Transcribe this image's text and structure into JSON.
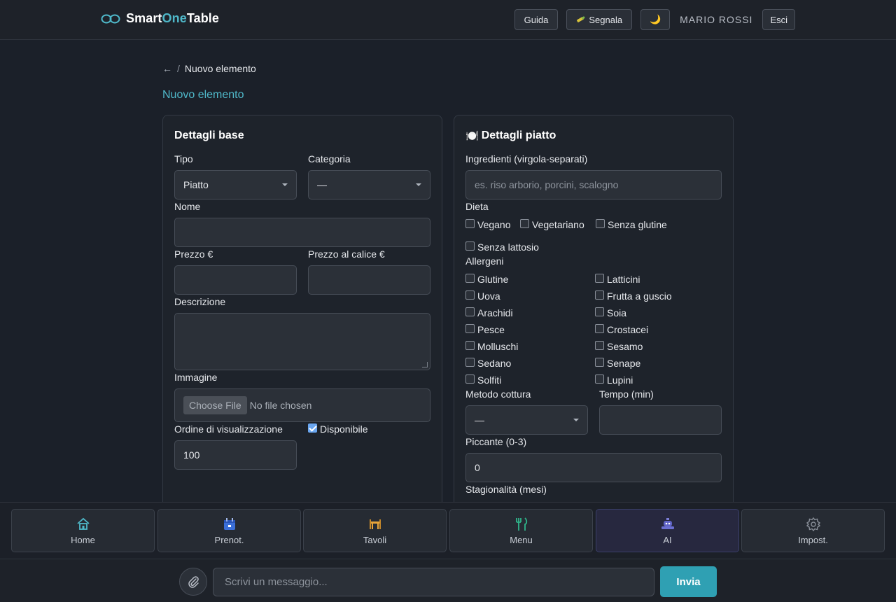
{
  "header": {
    "brand_part1": "Smart",
    "brand_part2": "One",
    "brand_part3": "Table",
    "guide_label": "Guida",
    "report_label": "Segnala",
    "theme_icon": "🌙",
    "user_name": "MARIO ROSSI",
    "logout_label": "Esci"
  },
  "breadcrumb": {
    "back_icon": "←",
    "separator": "/",
    "current": "Nuovo elemento"
  },
  "page_title": "Nuovo elemento",
  "basic": {
    "title": "Dettagli base",
    "type_label": "Tipo",
    "type_value": "Piatto",
    "category_label": "Categoria",
    "category_value": "—",
    "name_label": "Nome",
    "name_value": "",
    "price_label": "Prezzo €",
    "price_value": "",
    "glass_price_label": "Prezzo al calice €",
    "glass_price_value": "",
    "description_label": "Descrizione",
    "description_value": "",
    "image_label": "Immagine",
    "file_button": "Choose File",
    "file_status": "No file chosen",
    "order_label": "Ordine di visualizzazione",
    "order_value": "100",
    "available_label": "Disponibile",
    "available_checked": true
  },
  "dish": {
    "title_icon": "🍽️",
    "title": "Dettagli piatto",
    "ingredients_label": "Ingredienti (virgola-separati)",
    "ingredients_placeholder": "es. riso arborio, porcini, scalogno",
    "diet_label": "Dieta",
    "diet_options": [
      "Vegano",
      "Vegetariano",
      "Senza glutine",
      "Senza lattosio"
    ],
    "allergens_label": "Allergeni",
    "allergens": [
      "Glutine",
      "Latticini",
      "Uova",
      "Frutta a guscio",
      "Arachidi",
      "Soia",
      "Pesce",
      "Crostacei",
      "Molluschi",
      "Sesamo",
      "Sedano",
      "Senape",
      "Solfiti",
      "Lupini"
    ],
    "cooking_label": "Metodo cottura",
    "cooking_value": "—",
    "time_label": "Tempo (min)",
    "time_value": "",
    "spicy_label": "Piccante (0-3)",
    "spicy_value": "0",
    "season_label": "Stagionalità (mesi)"
  },
  "nav": {
    "items": [
      {
        "label": "Home",
        "icon": "home-icon"
      },
      {
        "label": "Prenot.",
        "icon": "calendar-icon"
      },
      {
        "label": "Tavoli",
        "icon": "table-icon"
      },
      {
        "label": "Menu",
        "icon": "cutlery-icon"
      },
      {
        "label": "AI",
        "icon": "robot-icon"
      },
      {
        "label": "Impost.",
        "icon": "gear-icon"
      }
    ],
    "active": "AI"
  },
  "chat": {
    "placeholder": "Scrivi un messaggio...",
    "send_label": "Invia"
  },
  "colors": {
    "accent": "#4fb8c9",
    "send": "#2fa0b3",
    "checkbox": "#6aa6f0"
  }
}
